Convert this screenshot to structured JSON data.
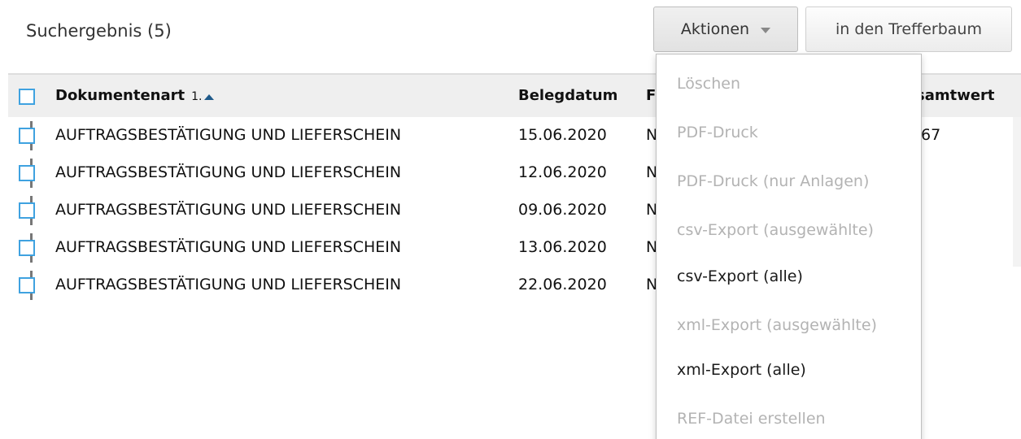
{
  "header": {
    "result_title": "Suchergebnis (5)",
    "actions_label": "Aktionen",
    "tree_button_label": "in den Trefferbaum"
  },
  "table": {
    "columns": {
      "doc_type": "Dokumentenart",
      "sort_rank": "1.",
      "date": "Belegdatum",
      "partial_f": "F",
      "total": "samtwert"
    },
    "rows": [
      {
        "doc_type": "AUFTRAGSBESTÄTIGUNG UND LIEFERSCHEIN",
        "date": "15.06.2020",
        "f": "N",
        "total": ",67"
      },
      {
        "doc_type": "AUFTRAGSBESTÄTIGUNG UND LIEFERSCHEIN",
        "date": "12.06.2020",
        "f": "N",
        "total": ""
      },
      {
        "doc_type": "AUFTRAGSBESTÄTIGUNG UND LIEFERSCHEIN",
        "date": "09.06.2020",
        "f": "N",
        "total": ""
      },
      {
        "doc_type": "AUFTRAGSBESTÄTIGUNG UND LIEFERSCHEIN",
        "date": "13.06.2020",
        "f": "N",
        "total": ""
      },
      {
        "doc_type": "AUFTRAGSBESTÄTIGUNG UND LIEFERSCHEIN",
        "date": "22.06.2020",
        "f": "N",
        "total": ""
      }
    ]
  },
  "actions_menu": {
    "items": [
      {
        "label": "Löschen",
        "enabled": false
      },
      {
        "label": "PDF-Druck",
        "enabled": false
      },
      {
        "label": "PDF-Druck (nur Anlagen)",
        "enabled": false
      },
      {
        "label": "csv-Export (ausgewählte)",
        "enabled": false
      },
      {
        "label": "csv-Export (alle)",
        "enabled": true
      },
      {
        "label": "xml-Export (ausgewählte)",
        "enabled": false
      },
      {
        "label": "xml-Export (alle)",
        "enabled": true
      },
      {
        "label": "REF-Datei erstellen",
        "enabled": false
      }
    ]
  },
  "colors": {
    "checkbox_border": "#3fa2e0",
    "sort_arrow": "#1f5a8a",
    "header_bg": "#efefef",
    "disabled_text": "#b3b3b3"
  },
  "icons": {
    "sort": "sort-ascending-icon",
    "dropdown": "caret-down-icon"
  }
}
